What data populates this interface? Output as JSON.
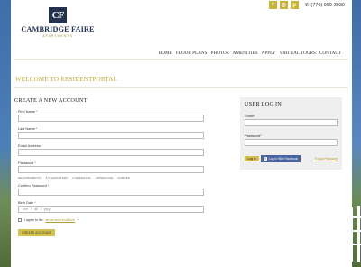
{
  "topbar": {
    "social_icons": [
      "facebook-icon",
      "instagram-icon",
      "pinterest-icon"
    ],
    "social_glyphs": [
      "f",
      "◎",
      "p"
    ],
    "phone": "(770) 969-3930"
  },
  "logo": {
    "monogram": "CF",
    "name": "CAMBRIDGE FAIRE",
    "sub": "APARTMENTS"
  },
  "nav": {
    "items": [
      "HOME",
      "FLOOR PLANS",
      "PHOTOS",
      "AMENITIES",
      "APPLY",
      "VIRTUAL TOURS",
      "CONTACT"
    ]
  },
  "welcome": "WELCOME TO RESIDENTPORTAL",
  "create": {
    "title": "CREATE A NEW ACCOUNT",
    "first_name": "First Name",
    "last_name": "Last Name",
    "email": "Email Address",
    "password": "Password",
    "requirements": [
      "REQUIREMENTS",
      "8 CHARACTERS",
      "LOWERCASE",
      "UPPERCASE",
      "NUMBER"
    ],
    "confirm_password": "Confirm Password",
    "dob": "Birth Date",
    "dob_mm": "mm",
    "dob_dd": "dd",
    "dob_yyyy": "yyyy",
    "terms_prefix": "I agree to the",
    "terms_link": "terms and conditions",
    "submit": "CREATE ACCOUNT",
    "required_mark": "*"
  },
  "login": {
    "title": "USER LOG IN",
    "email": "Email",
    "password": "Password",
    "login_button": "Log In",
    "facebook_button": "Log In With Facebook",
    "forgot": "Forgot Password"
  },
  "colors": {
    "accent": "#c2aa35",
    "navy": "#23324f",
    "facebook": "#4a63a4"
  }
}
